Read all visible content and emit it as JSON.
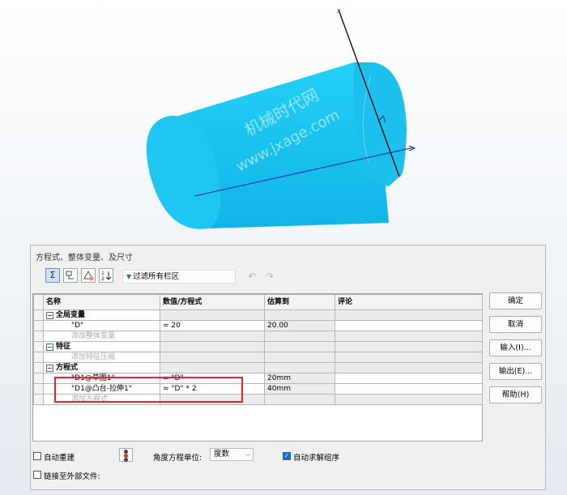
{
  "viewport": {
    "watermark_line1": "机械时代网",
    "watermark_line2": "www.jxage.com",
    "colors": {
      "cylinder": "#1ec8f2",
      "cylinder_dark": "#10a9dd",
      "axis": "#1a2a9a",
      "axis_line": "#000000"
    }
  },
  "dialog": {
    "title": "方程式、整体变量、及尺寸",
    "toolbar": {
      "sigma_icon": "Σ",
      "tree_icon": "tree-view-icon",
      "sort_icon": "sort-icon",
      "order_icon": "order-icon",
      "filter_placeholder": "过滤所有栏区",
      "undo_icon": "↶",
      "redo_icon": "↷"
    },
    "table": {
      "headers": [
        "名称",
        "数值/方程式",
        "估算到",
        "评论"
      ],
      "groups": {
        "global": {
          "title": "全局变量",
          "rows": [
            {
              "name": "\"D\"",
              "value": "= 20",
              "eval": "20.00",
              "comment": ""
            }
          ],
          "add_placeholder": "添加整体变量"
        },
        "features": {
          "title": "特征",
          "add_placeholder": "添加特征压缩"
        },
        "equations": {
          "title": "方程式",
          "rows": [
            {
              "name": "\"D1@草图1\"",
              "value": "= \"D\"",
              "eval": "20mm",
              "comment": ""
            },
            {
              "name": "\"D1@凸台-拉伸1\"",
              "value": "= \"D\" * 2",
              "eval": "40mm",
              "comment": ""
            }
          ],
          "add_placeholder": "添加方程式"
        }
      }
    },
    "buttons": {
      "ok": "确定",
      "cancel": "取消",
      "import": "输入(I)...",
      "export": "输出(E)...",
      "help": "帮助(H)"
    },
    "bottom": {
      "auto_rebuild": "自动重建",
      "angle_unit_label": "角度方程单位:",
      "angle_unit_value": "度数",
      "auto_solve": "自动求解组序",
      "link_external": "链接至外部文件:"
    },
    "highlight_color": "#e0262a"
  }
}
